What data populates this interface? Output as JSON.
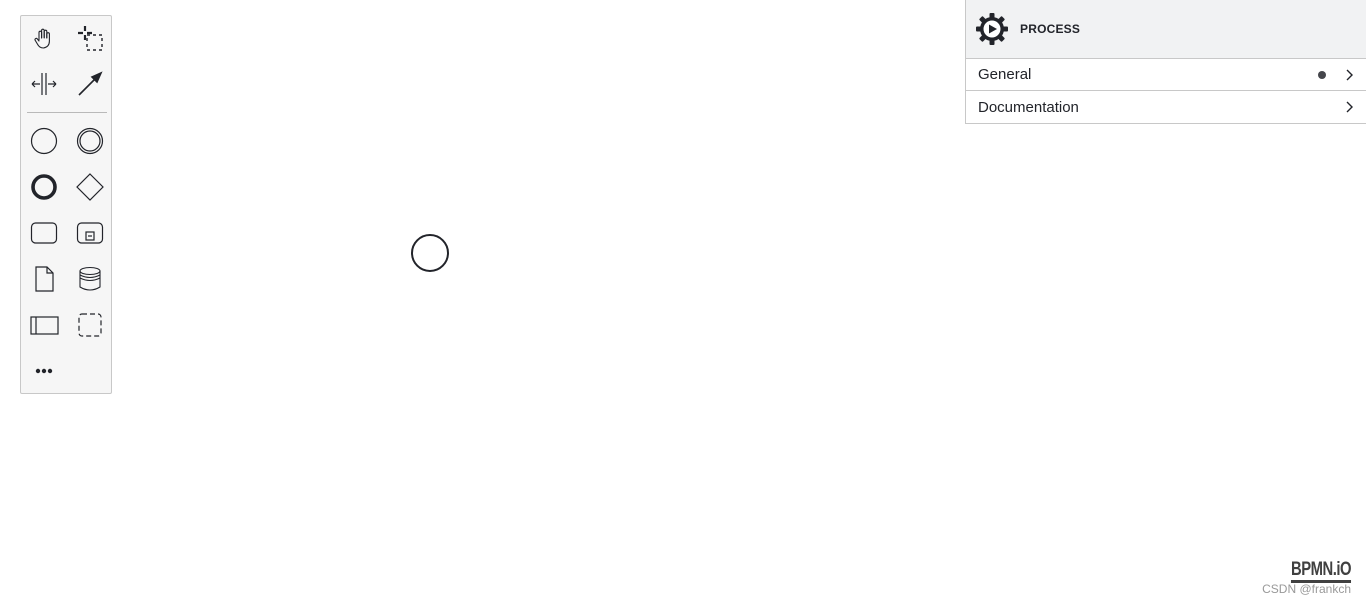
{
  "palette": {
    "tools": [
      {
        "id": "hand",
        "icon": "hand-tool-icon"
      },
      {
        "id": "lasso",
        "icon": "lasso-tool-icon"
      },
      {
        "id": "space",
        "icon": "space-tool-icon"
      },
      {
        "id": "connect",
        "icon": "global-connect-tool-icon"
      },
      {
        "id": "start-event",
        "icon": "start-event-icon"
      },
      {
        "id": "intermediate-event",
        "icon": "intermediate-event-icon"
      },
      {
        "id": "end-event",
        "icon": "end-event-icon"
      },
      {
        "id": "gateway",
        "icon": "gateway-icon"
      },
      {
        "id": "task",
        "icon": "task-icon"
      },
      {
        "id": "subprocess",
        "icon": "subprocess-icon"
      },
      {
        "id": "data-object",
        "icon": "data-object-icon"
      },
      {
        "id": "data-store",
        "icon": "data-store-icon"
      },
      {
        "id": "participant",
        "icon": "participant-icon"
      },
      {
        "id": "group",
        "icon": "group-icon"
      },
      {
        "id": "more",
        "icon": "more-icon"
      }
    ]
  },
  "properties_panel": {
    "header_icon": "process-icon",
    "title": "PROCESS",
    "groups": [
      {
        "label": "General",
        "has_entries": true
      },
      {
        "label": "Documentation",
        "has_entries": false
      }
    ]
  },
  "watermark": {
    "logo_text": "BPMN.iO",
    "credit": "CSDN @frankch"
  },
  "colors": {
    "stroke": "#22242a",
    "palette_bg": "#f6f6f6",
    "header_bg": "#f1f2f3",
    "border": "#c8c8c8"
  }
}
